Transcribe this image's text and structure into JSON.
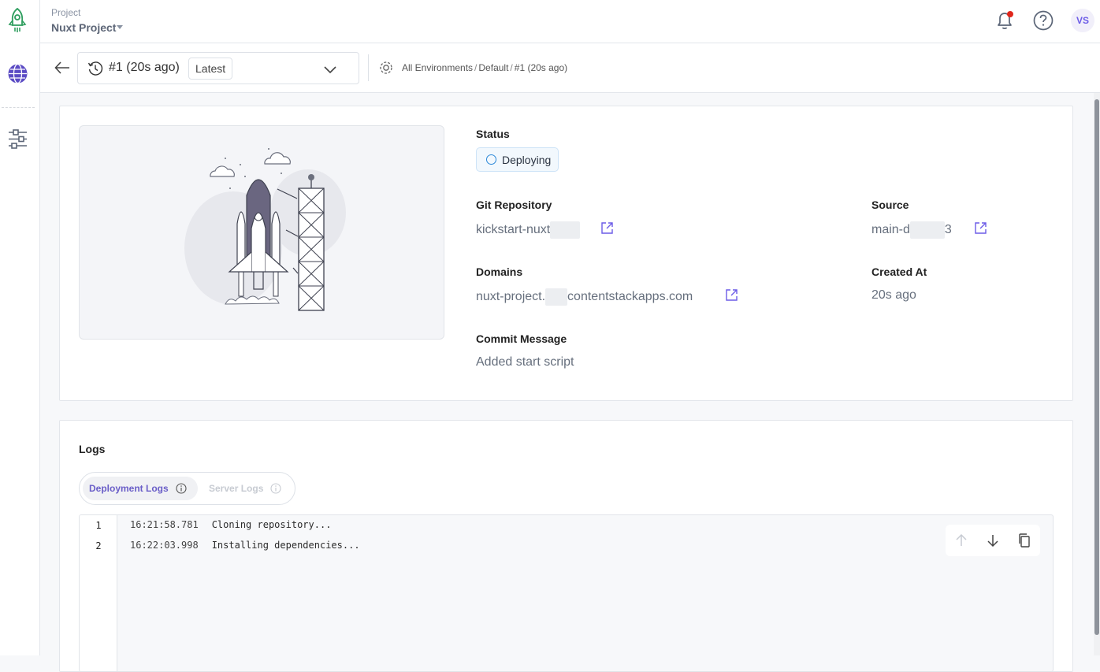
{
  "header": {
    "project_label": "Project",
    "project_name": "Nuxt Project",
    "avatar_initials": "VS"
  },
  "subheader": {
    "deployment_selected": "#1 (20s ago)",
    "latest_badge": "Latest",
    "breadcrumb": [
      "All Environments",
      "Default",
      "#1 (20s ago)"
    ]
  },
  "summary": {
    "status_label": "Status",
    "status_value": "Deploying",
    "git_label": "Git Repository",
    "git_value": "kickstart-nuxt",
    "source_label": "Source",
    "source_prefix": "main-d",
    "source_suffix": "3",
    "domains_label": "Domains",
    "domains_prefix": "nuxt-project.",
    "domains_suffix": "contentstackapps.com",
    "created_label": "Created At",
    "created_value": "20s ago",
    "commit_label": "Commit Message",
    "commit_value": "Added start script"
  },
  "logs": {
    "title": "Logs",
    "tabs": [
      {
        "label": "Deployment Logs",
        "active": true
      },
      {
        "label": "Server Logs",
        "active": false
      }
    ],
    "lines": [
      {
        "n": "1",
        "time": "16:21:58.781",
        "text": "Cloning repository..."
      },
      {
        "n": "2",
        "time": "16:22:03.998",
        "text": "Installing dependencies..."
      }
    ]
  },
  "colors": {
    "accent": "#6c5ce7",
    "status_ring": "#2b88d8",
    "notification_dot": "#e0261b",
    "logo_green": "#2f9e5f"
  },
  "icons": [
    "rocket-logo-icon",
    "globe-icon",
    "sliders-icon",
    "bell-icon",
    "help-icon",
    "arrow-left-icon",
    "history-icon",
    "chevron-down-icon",
    "environment-icon",
    "external-link-icon",
    "info-icon",
    "arrow-up-icon",
    "arrow-down-icon",
    "copy-icon"
  ]
}
